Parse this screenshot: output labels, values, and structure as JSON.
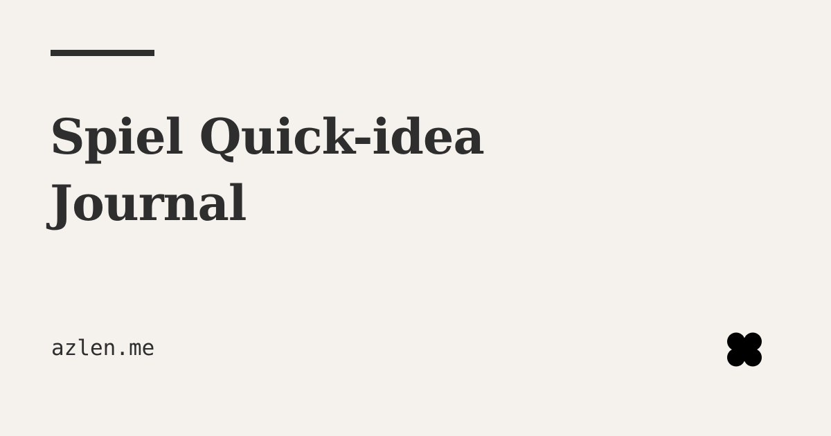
{
  "page": {
    "title": "Spiel Quick-idea Journal",
    "domain": "azlen.me"
  },
  "logo": {
    "icon": "clover-logo-icon"
  },
  "colors": {
    "background": "#f5f2ee",
    "text": "#2e2e2e",
    "logo": "#000000"
  }
}
